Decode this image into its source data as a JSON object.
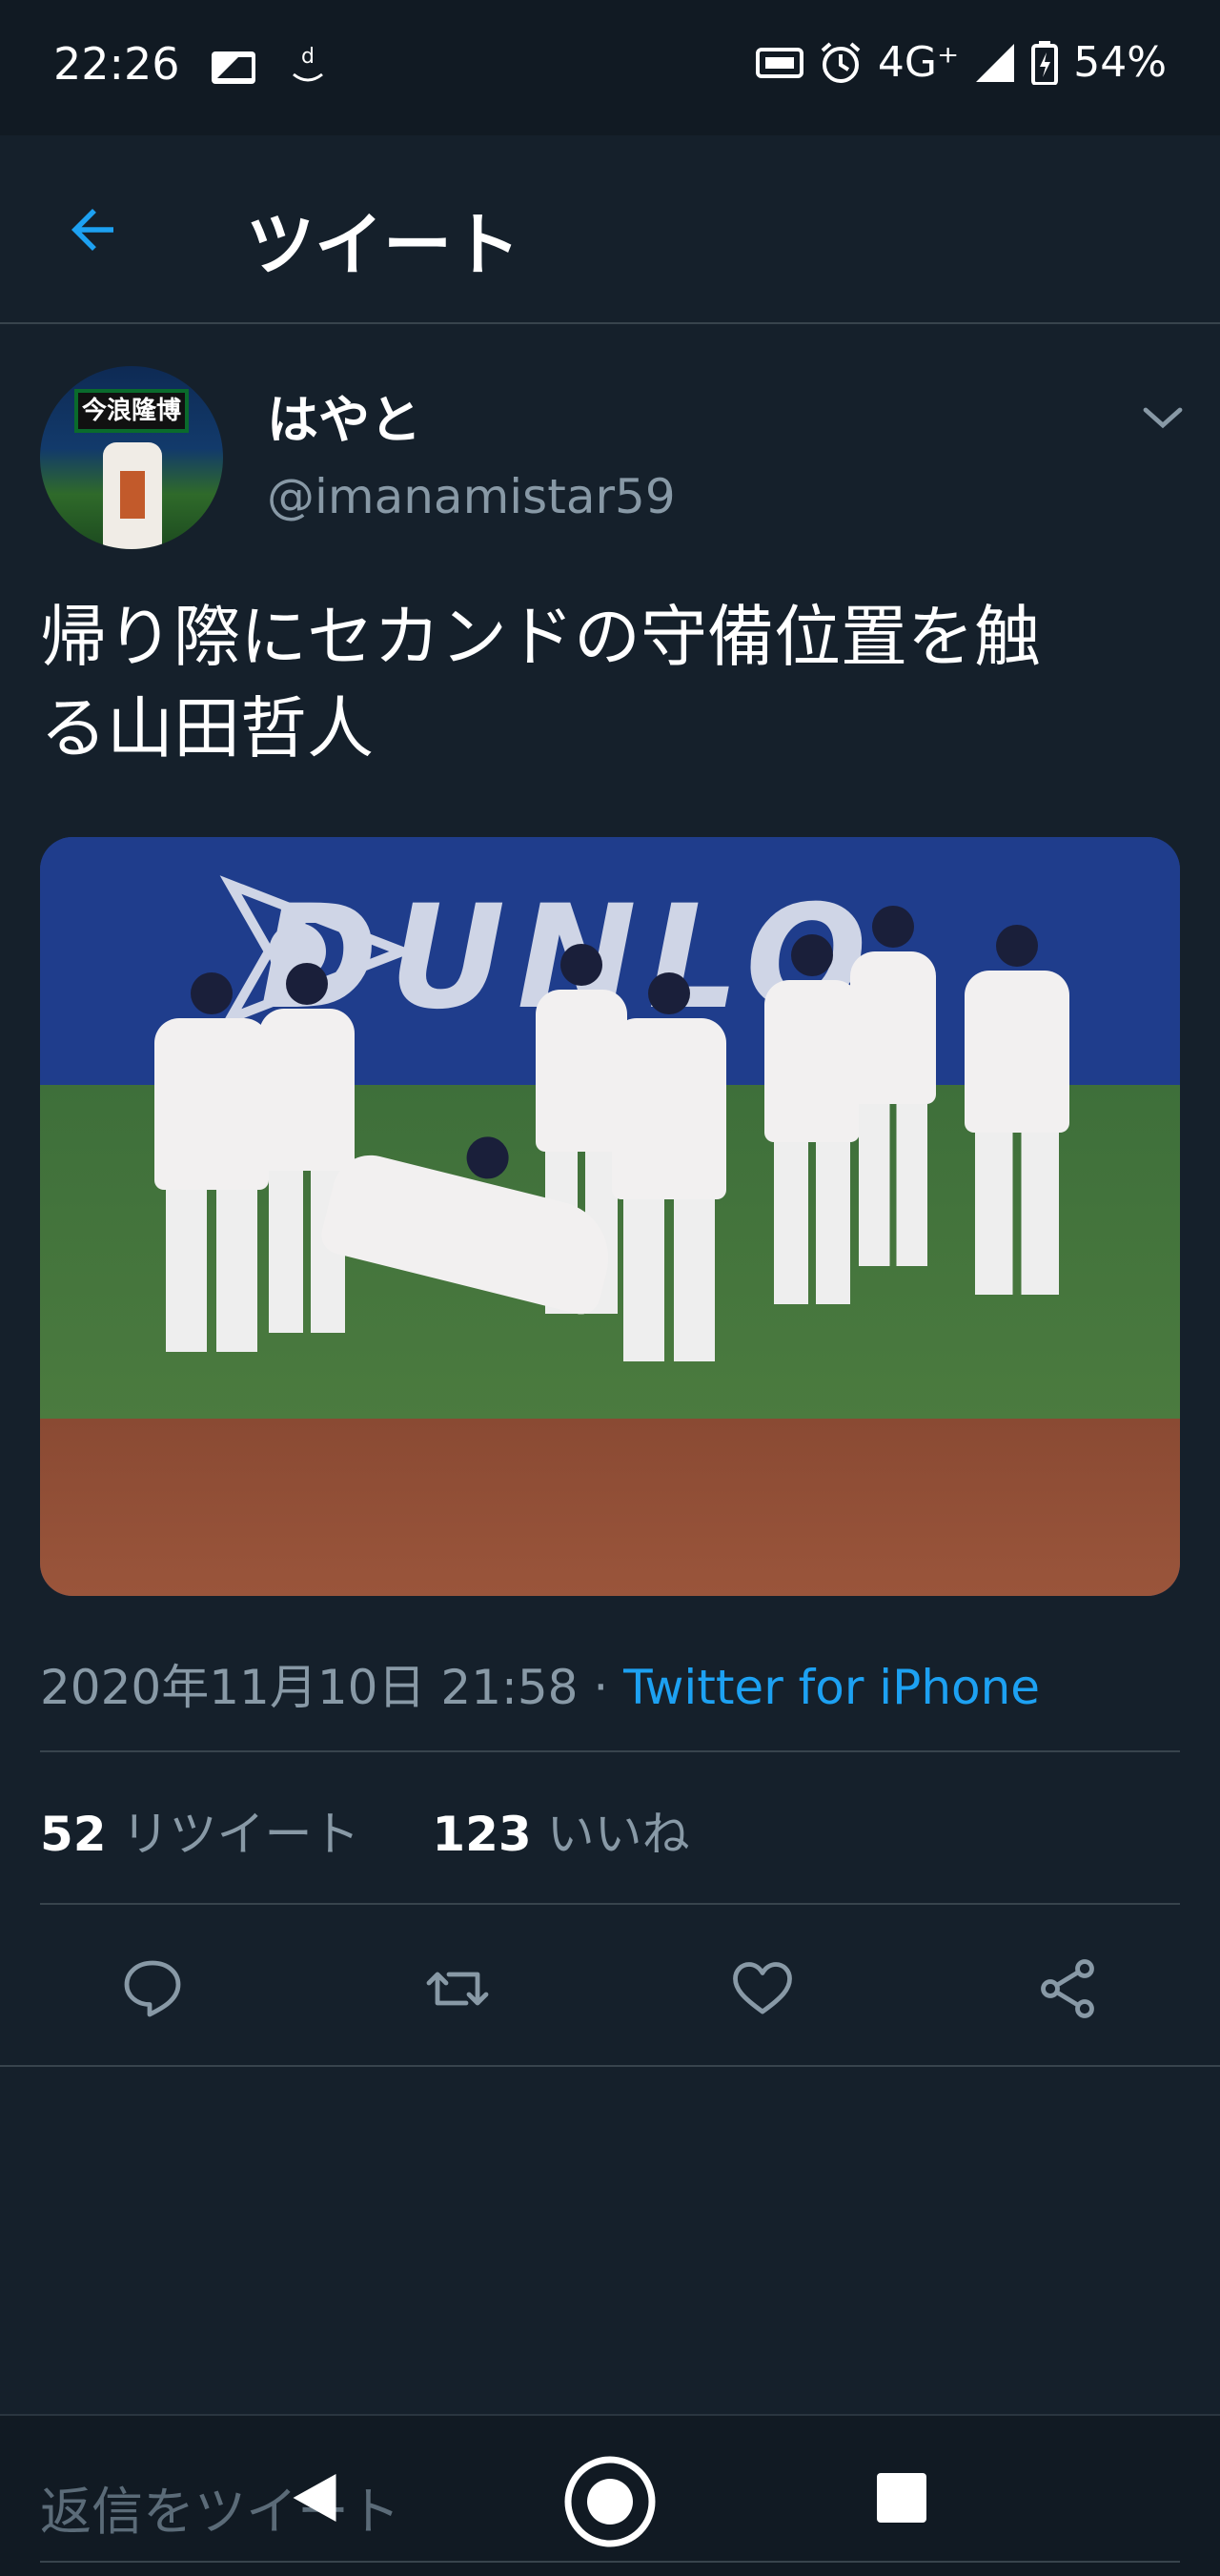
{
  "status_bar": {
    "time": "22:26",
    "network": "4G⁺",
    "battery": "54%"
  },
  "header": {
    "title": "ツイート"
  },
  "tweet": {
    "display_name": "はやと",
    "handle": "@imanamistar59",
    "text_line1": "帰り際にセカンドの守備位置を触",
    "text_line2": "る山田哲人",
    "date": "2020年11月10日 21:58",
    "separator": " · ",
    "source": "Twitter for iPhone",
    "retweet_count": "52",
    "retweet_label": "リツイート",
    "like_count": "123",
    "like_label": "いいね",
    "photo_wall_text": "DUNLO",
    "avatar_sign_text": "今浪隆博"
  },
  "reply_bar": {
    "placeholder": "返信をツイート"
  },
  "icons": [
    "back-arrow-icon",
    "chevron-down-icon",
    "reply-icon",
    "retweet-icon",
    "like-icon",
    "share-icon"
  ],
  "colors": {
    "background": "#15202b",
    "accent": "#1da1f2",
    "muted": "#8899a6",
    "divider": "#38444d"
  }
}
